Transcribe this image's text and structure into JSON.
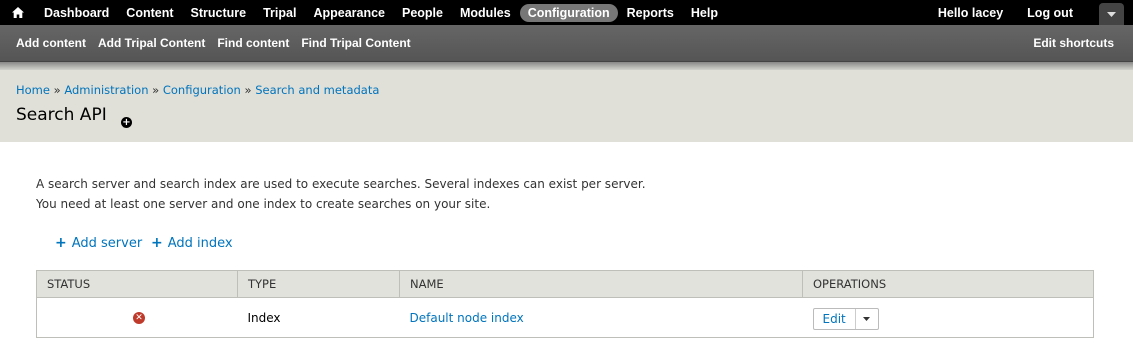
{
  "toolbar": {
    "menu": [
      "Dashboard",
      "Content",
      "Structure",
      "Tripal",
      "Appearance",
      "People",
      "Modules",
      "Configuration",
      "Reports",
      "Help"
    ],
    "active": "Configuration",
    "hello_prefix": "Hello ",
    "user": "lacey",
    "logout": "Log out"
  },
  "shortcuts": {
    "items": [
      "Add content",
      "Add Tripal Content",
      "Find content",
      "Find Tripal Content"
    ],
    "edit": "Edit shortcuts"
  },
  "breadcrumb": {
    "items": [
      "Home",
      "Administration",
      "Configuration",
      "Search and metadata"
    ],
    "separator": "»"
  },
  "page": {
    "title": "Search API",
    "description_1": "A search server and search index are used to execute searches. Several indexes can exist per server.",
    "description_2": "You need at least one server and one index to create searches on your site.",
    "add_server": "Add server",
    "add_index": "Add index"
  },
  "table": {
    "headers": [
      "STATUS",
      "TYPE",
      "NAME",
      "OPERATIONS"
    ],
    "rows": [
      {
        "status": "disabled",
        "type": "Index",
        "name": "Default node index",
        "operation": "Edit"
      }
    ]
  },
  "colors": {
    "link": "#0074bd",
    "active_tab": "#777777",
    "status_error": "#c03a2b"
  },
  "icons": [
    "home-icon",
    "drawer-toggle-icon",
    "shortcut-add-icon",
    "plus-icon",
    "error-icon",
    "caret-down-icon"
  ]
}
